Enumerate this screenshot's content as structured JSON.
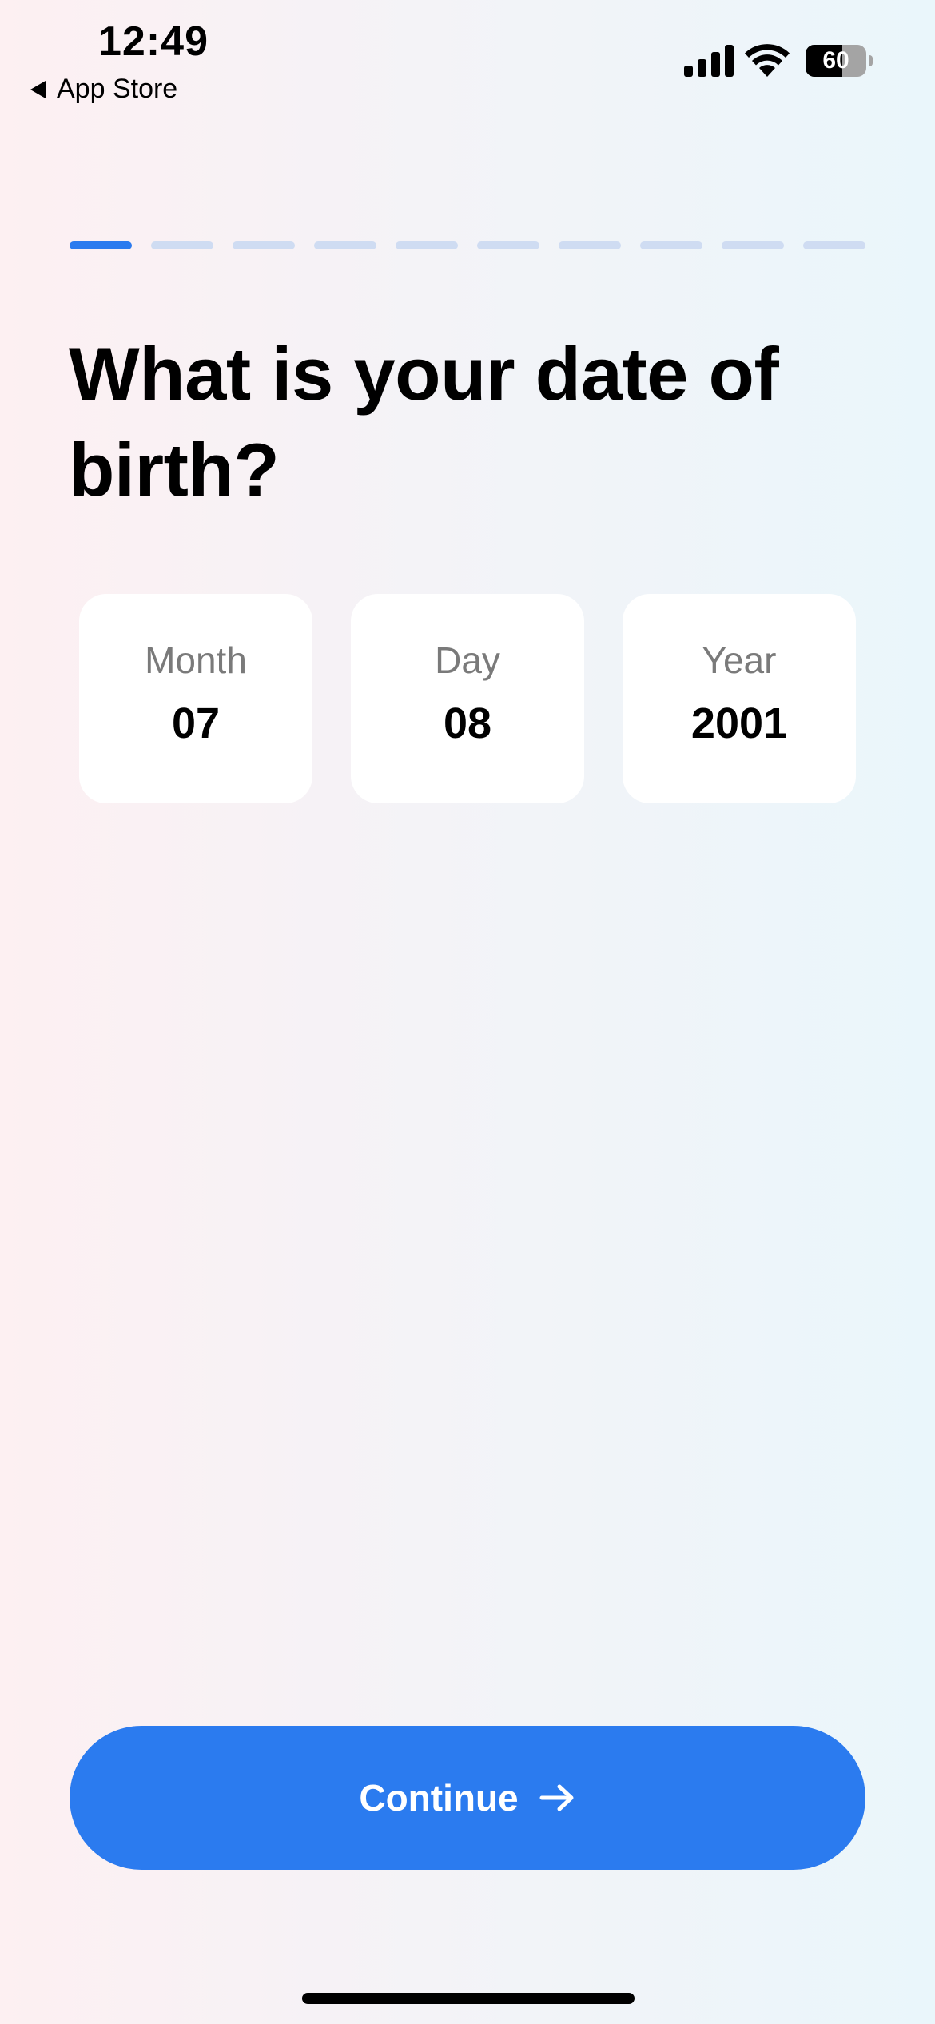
{
  "status_bar": {
    "time": "12:49",
    "back_label": "App Store",
    "battery_level": "60",
    "battery_fraction": 0.6
  },
  "progress": {
    "total_steps": 10,
    "current_step": 1,
    "active_color": "#2b7bef",
    "inactive_color": "#cfdcf2"
  },
  "question": {
    "title": "What is your date of birth?"
  },
  "date_fields": [
    {
      "label": "Month",
      "value": "07"
    },
    {
      "label": "Day",
      "value": "08"
    },
    {
      "label": "Year",
      "value": "2001"
    }
  ],
  "continue_button": {
    "label": "Continue",
    "color": "#2b7bef",
    "icon": "arrow-right-icon"
  }
}
